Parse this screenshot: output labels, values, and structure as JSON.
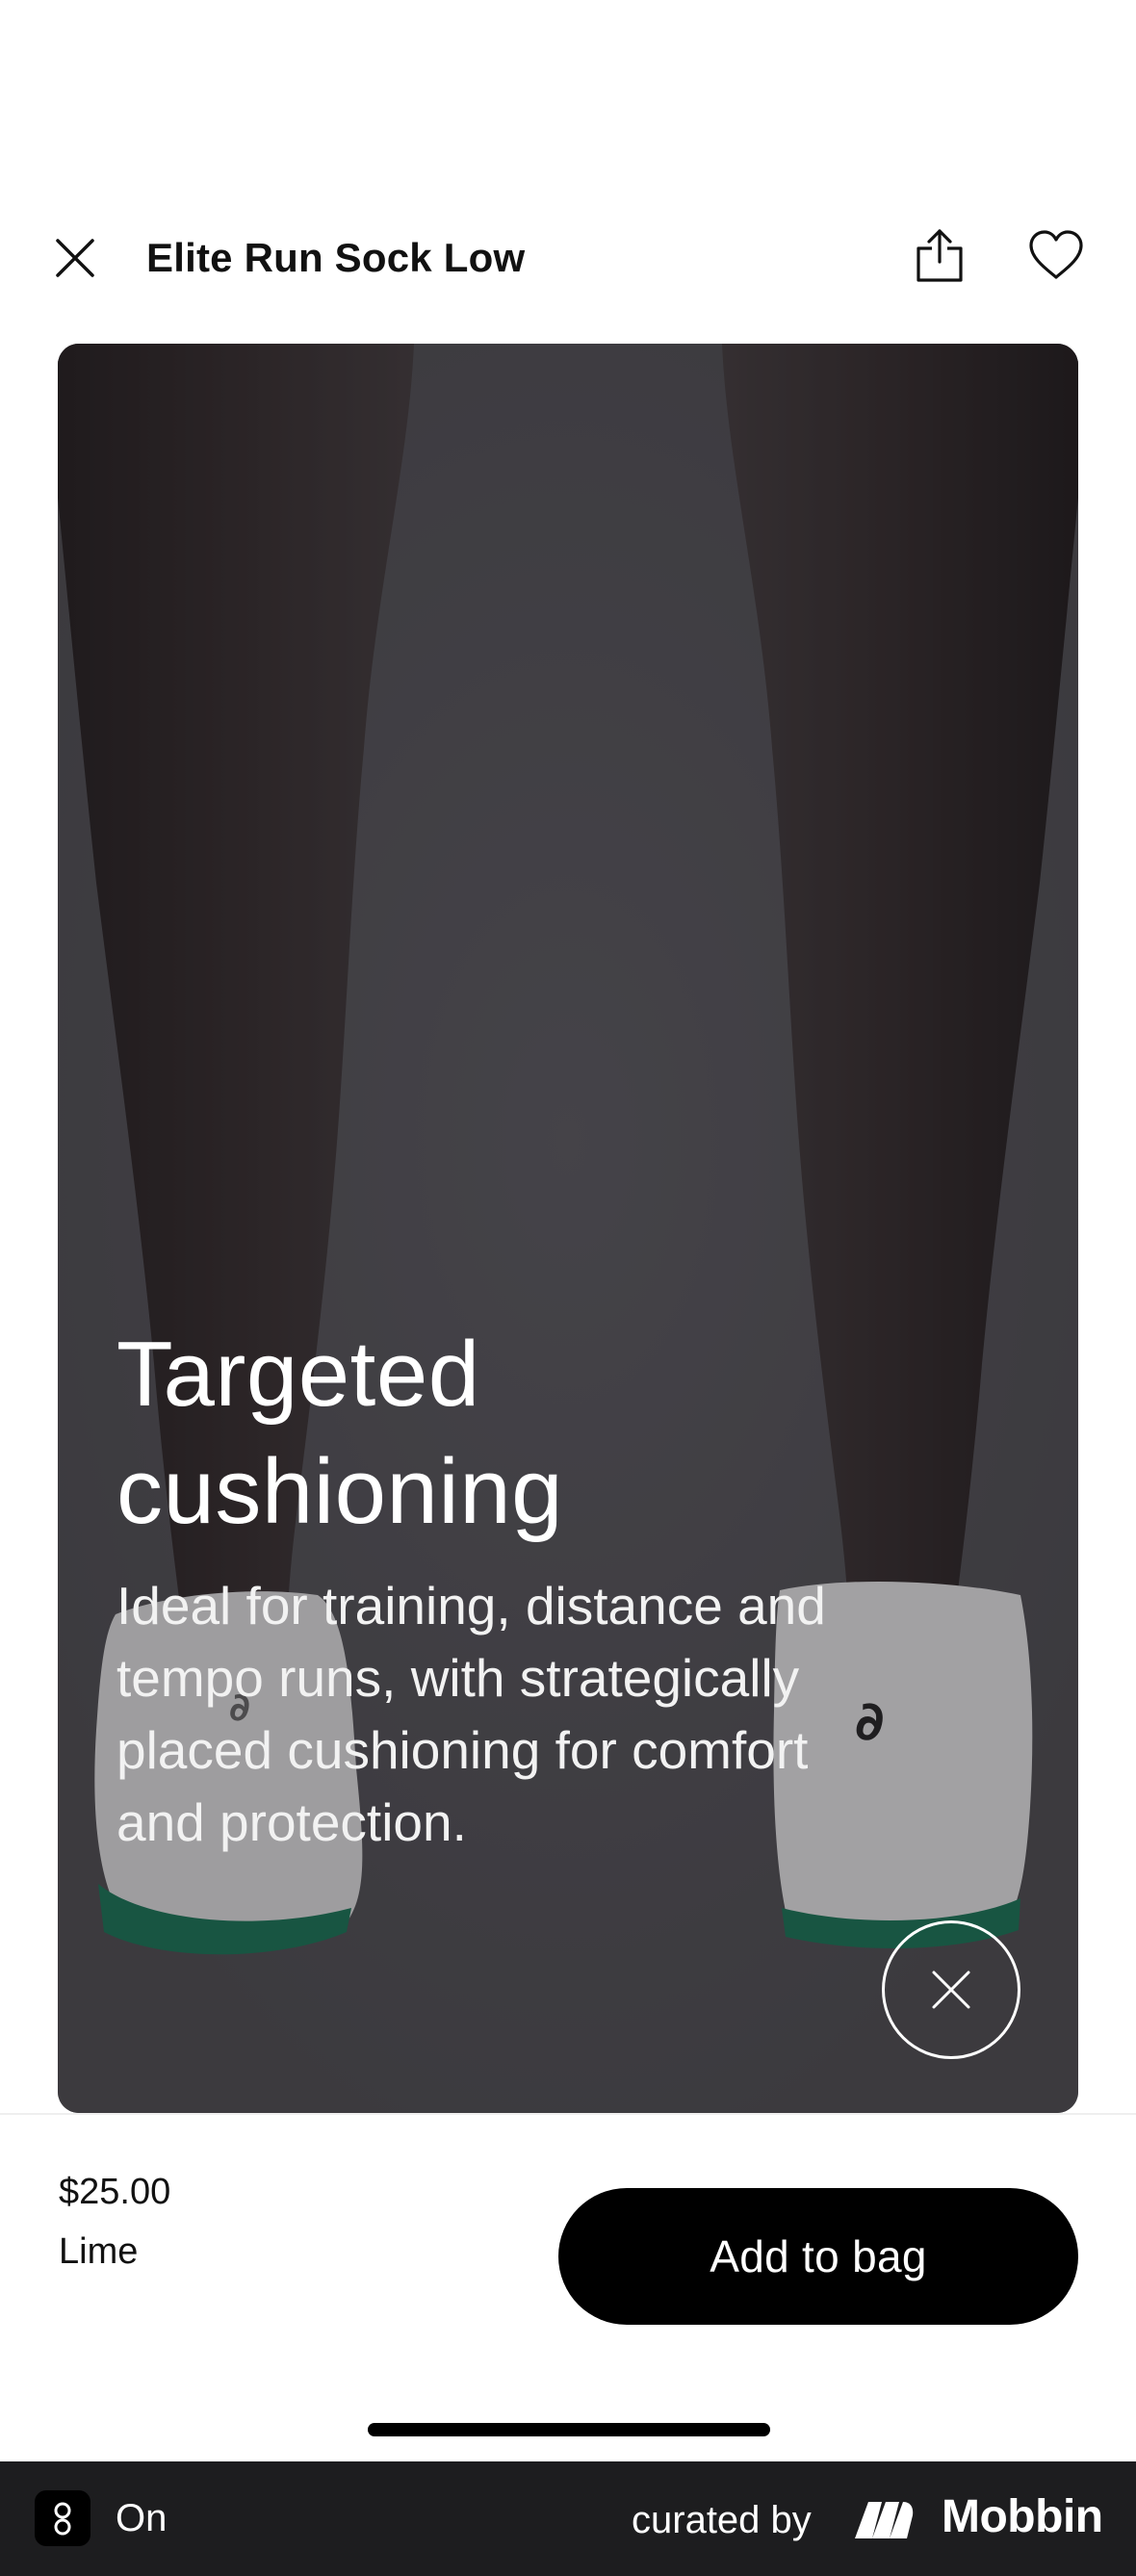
{
  "header": {
    "title": "Elite Run Sock Low",
    "close_icon": "close-icon",
    "share_icon": "share-icon",
    "favorite_icon": "heart-icon"
  },
  "hero": {
    "title": "Targeted cushioning",
    "description": "Ideal for training, distance and tempo runs, with strategically placed cushioning for comfort and protection.",
    "close_icon": "close-icon"
  },
  "product": {
    "price": "$25.00",
    "color": "Lime",
    "add_button_label": "Add to bag"
  },
  "footer": {
    "app_name": "On",
    "curated_by": "curated by",
    "brand": "Mobbin"
  },
  "colors": {
    "overlay": "#4a494d",
    "button": "#000000",
    "footer": "#1d1d1f",
    "sock_sole": "#0f7a55"
  }
}
